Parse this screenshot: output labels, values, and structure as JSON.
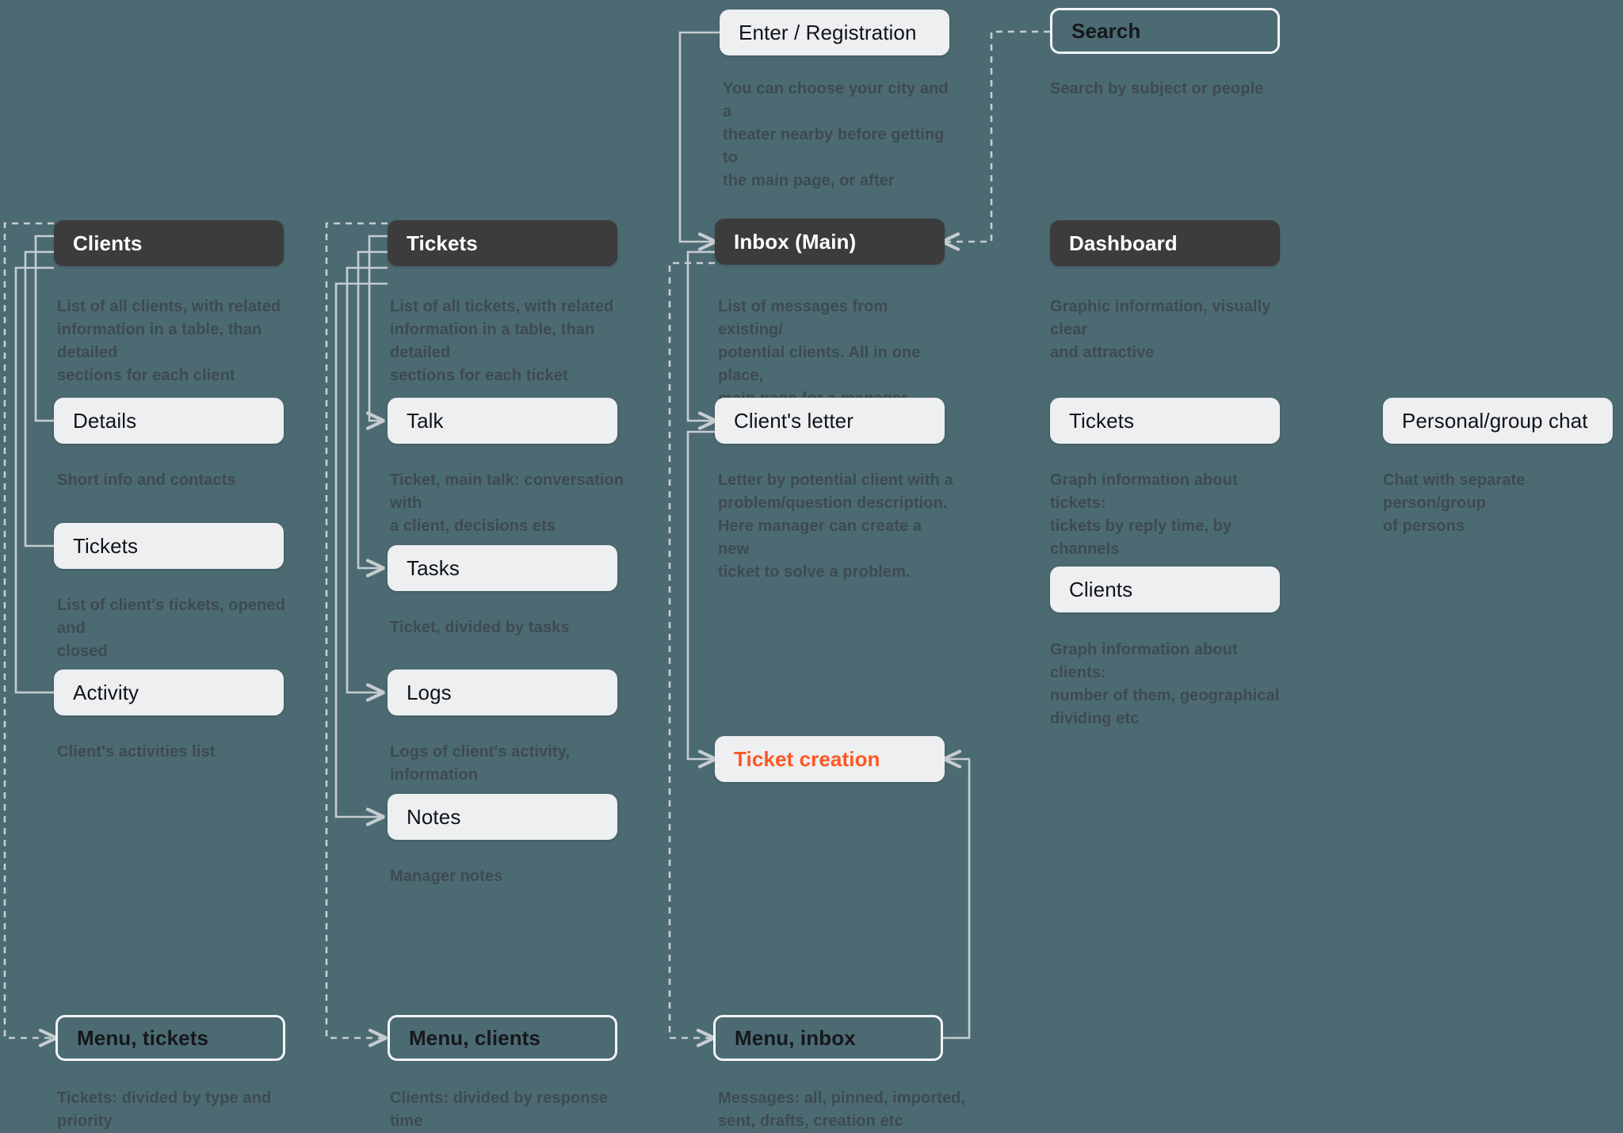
{
  "canvas": {
    "background": "#4C6A72",
    "header_card_bg": "#3C3C3C",
    "light_card_bg": "#EDEFF1",
    "accent_color": "#FF5722",
    "connector_color": "#C6CDD0",
    "description_color": "#3D4B50"
  },
  "columns": [
    {
      "id": "clients",
      "header": {
        "label": "Clients",
        "style": "header"
      },
      "header_desc": "List of all clients, with related\ninformation in a table, than detailed\nsections for each client",
      "items": [
        {
          "label": "Details",
          "style": "light",
          "desc": "Short info and contacts"
        },
        {
          "label": "Tickets",
          "style": "light",
          "desc": "List of client's tickets, opened and\nclosed"
        },
        {
          "label": "Activity",
          "style": "light",
          "desc": "Client's activities list"
        }
      ],
      "menu": {
        "label": "Menu, tickets",
        "style": "outline",
        "desc": "Tickets:  divided by type and\npriority"
      }
    },
    {
      "id": "tickets",
      "header": {
        "label": "Tickets",
        "style": "header"
      },
      "header_desc": "List of all tickets, with related\ninformation in a table, than detailed\nsections for each ticket",
      "items": [
        {
          "label": "Talk",
          "style": "light",
          "desc": "Ticket, main talk: conversation with\na client, decisions ets"
        },
        {
          "label": "Tasks",
          "style": "light",
          "desc": "Ticket, divided by tasks"
        },
        {
          "label": "Logs",
          "style": "light",
          "desc": "Logs of client's activity, information"
        },
        {
          "label": "Notes",
          "style": "light",
          "desc": "Manager notes"
        }
      ],
      "menu": {
        "label": "Menu, clients",
        "style": "outline",
        "desc": "Clients: divided by response time"
      }
    },
    {
      "id": "inbox",
      "top": {
        "label": "Enter / Registration",
        "style": "light",
        "desc": "You can choose your city and a\ntheater nearby before getting to\nthe main page, or after"
      },
      "header": {
        "label": "Inbox (Main)",
        "style": "header"
      },
      "header_desc": "List of messages from existing/\npotential clients. All in one place,\nmain page for a manager.",
      "items": [
        {
          "label": "Client's letter",
          "style": "light",
          "desc": "Letter by potential client with a\nproblem/question description.\nHere manager can create a new\nticket to solve a problem."
        },
        {
          "label": "Ticket creation",
          "style": "light accent",
          "desc": ""
        }
      ],
      "menu": {
        "label": "Menu, inbox",
        "style": "outline",
        "desc": "Messages: all, pinned, imported,\nsent, drafts, creation etc"
      }
    },
    {
      "id": "dashboard",
      "top": {
        "label": "Search",
        "style": "outline",
        "desc": "Search by subject or people"
      },
      "header": {
        "label": "Dashboard",
        "style": "header"
      },
      "header_desc": "Graphic information, visually clear\nand attractive",
      "items": [
        {
          "label": "Tickets",
          "style": "light",
          "desc": "Graph information about tickets:\ntickets by reply time, by channels\netc"
        },
        {
          "label": "Clients",
          "style": "light",
          "desc": "Graph information about clients:\nnumber of them, geographical\ndividing etc"
        }
      ]
    },
    {
      "id": "chat",
      "items": [
        {
          "label": "Personal/group chat",
          "style": "light",
          "desc": "Chat with separate person/group\nof persons"
        }
      ]
    }
  ]
}
